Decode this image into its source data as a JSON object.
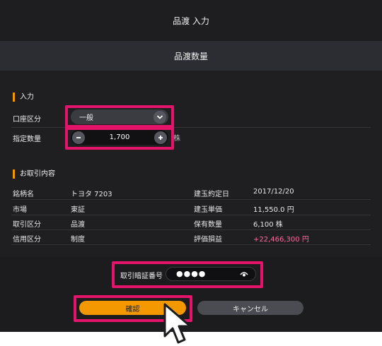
{
  "header": {
    "title": "品渡 入力"
  },
  "subheader": {
    "title": "品渡数量"
  },
  "input_section": {
    "title": "入力",
    "account_label": "口座区分",
    "account_value": "一般",
    "quantity_label": "指定数量",
    "quantity_value": "1,700",
    "quantity_unit": "株"
  },
  "order_section": {
    "title": "お取引内容",
    "rows": [
      {
        "left_label": "銘柄名",
        "left_value": "トヨタ 7203",
        "right_label": "建玉約定日",
        "right_value": "2017/12/20"
      },
      {
        "left_label": "市場",
        "left_value": "東証",
        "right_label": "建玉単価",
        "right_value": "11,550.0 円"
      },
      {
        "left_label": "取引区分",
        "left_value": "品渡",
        "right_label": "保有数量",
        "right_value": "6,100 株"
      },
      {
        "left_label": "信用区分",
        "left_value": "制度",
        "right_label": "評価損益",
        "right_value": "+22,466,300 円"
      }
    ]
  },
  "pin": {
    "label": "取引暗証番号",
    "masked_value": "●●●●"
  },
  "buttons": {
    "confirm": "確認",
    "cancel": "キャンセル"
  },
  "colors": {
    "accent": "#f39800",
    "highlight": "#e4146a",
    "positive": "#ff6b9a"
  },
  "icons": [
    "chevron-down-icon",
    "minus-icon",
    "plus-icon",
    "eye-icon",
    "mouse-cursor-icon"
  ]
}
